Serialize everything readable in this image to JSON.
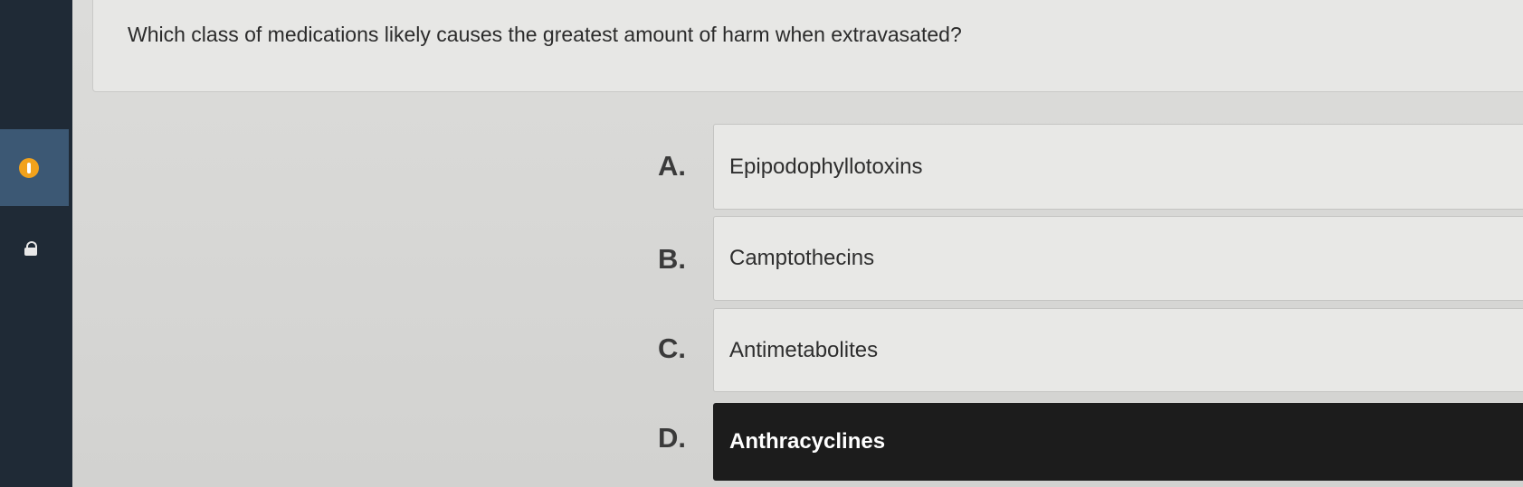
{
  "question": {
    "text": "Which class of medications likely causes the greatest amount of harm when extravasated?"
  },
  "sidebar": {
    "items": [
      {
        "icon": "warning-icon",
        "state": "active"
      },
      {
        "icon": "lock-icon",
        "state": "inactive"
      }
    ]
  },
  "answers": [
    {
      "letter": "A.",
      "text": "Epipodophyllotoxins",
      "selected": false
    },
    {
      "letter": "B.",
      "text": "Camptothecins",
      "selected": false
    },
    {
      "letter": "C.",
      "text": "Antimetabolites",
      "selected": false
    },
    {
      "letter": "D.",
      "text": "Anthracyclines",
      "selected": true
    }
  ],
  "colors": {
    "rail": "#1f2a36",
    "rail_active": "#3c5874",
    "warning": "#f2a21c",
    "selected_answer": "#1c1c1c"
  }
}
